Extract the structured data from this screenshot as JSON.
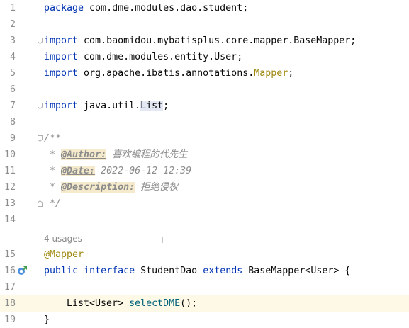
{
  "editor": {
    "lines": [
      {
        "n": "1",
        "parts": [
          [
            "kw",
            "package"
          ],
          [
            "",
            "com.dme.modules.dao.student;"
          ]
        ]
      },
      {
        "n": "2",
        "parts": []
      },
      {
        "n": "3",
        "parts": [
          [
            "kw",
            "import"
          ],
          [
            "",
            "com.baomidou.mybatisplus.core.mapper.BaseMapper;"
          ]
        ]
      },
      {
        "n": "4",
        "parts": [
          [
            "kw",
            "import"
          ],
          [
            "",
            "com.dme.modules.entity.User;"
          ]
        ]
      },
      {
        "n": "5",
        "parts": [
          [
            "kw",
            "import"
          ],
          [
            "",
            "org.apache.ibatis.annotations."
          ],
          [
            "ann",
            "Mapper"
          ],
          [
            "",
            ";"
          ]
        ]
      },
      {
        "n": "6",
        "parts": []
      },
      {
        "n": "7",
        "parts": [
          [
            "kw",
            "import"
          ],
          [
            "",
            "java.util."
          ],
          [
            "hl",
            "List"
          ],
          [
            "",
            ";"
          ]
        ]
      },
      {
        "n": "8",
        "parts": []
      },
      {
        "n": "9",
        "parts": [
          [
            "cmt",
            "/**"
          ]
        ]
      },
      {
        "n": "10",
        "parts": [
          [
            "cmt",
            " * "
          ],
          [
            "tag",
            "@Author:"
          ],
          [
            "cmt",
            " 喜欢编程的代先生"
          ]
        ]
      },
      {
        "n": "11",
        "parts": [
          [
            "cmt",
            " * "
          ],
          [
            "tag",
            "@Date:"
          ],
          [
            "cmt",
            " 2022-06-12 12:39"
          ]
        ]
      },
      {
        "n": "12",
        "parts": [
          [
            "cmt",
            " * "
          ],
          [
            "tag",
            "@Description:"
          ],
          [
            "cmt",
            " 拒绝侵权"
          ]
        ]
      },
      {
        "n": "13",
        "parts": [
          [
            "cmt",
            " */"
          ]
        ]
      },
      {
        "n": "14",
        "parts": []
      },
      {
        "n": "15",
        "parts": [
          [
            "ann",
            "@Mapper"
          ]
        ]
      },
      {
        "n": "16",
        "parts": [
          [
            "kw",
            "public"
          ],
          [
            "",
            " "
          ],
          [
            "kw",
            "interface"
          ],
          [
            "",
            " StudentDao "
          ],
          [
            "kw",
            "extends"
          ],
          [
            "",
            " BaseMapper<User> {"
          ]
        ]
      },
      {
        "n": "17",
        "parts": []
      },
      {
        "n": "18",
        "parts": [
          [
            "",
            "    List<User> "
          ],
          [
            "method",
            "selectDME"
          ],
          [
            "",
            "();"
          ]
        ]
      },
      {
        "n": "19",
        "parts": [
          [
            "",
            "}"
          ]
        ]
      }
    ],
    "usages_hint": "4 usages",
    "cursor_glyph": "I",
    "current_line": "18"
  },
  "icons": {
    "fold": "fold-marker-icon",
    "gutter": "implemented-interface-icon"
  },
  "colors": {
    "keyword": "#0033b3",
    "annotation": "#9e880d",
    "comment": "#8c8c8c",
    "method": "#00627a",
    "current_line_bg": "#fdf9e6"
  }
}
